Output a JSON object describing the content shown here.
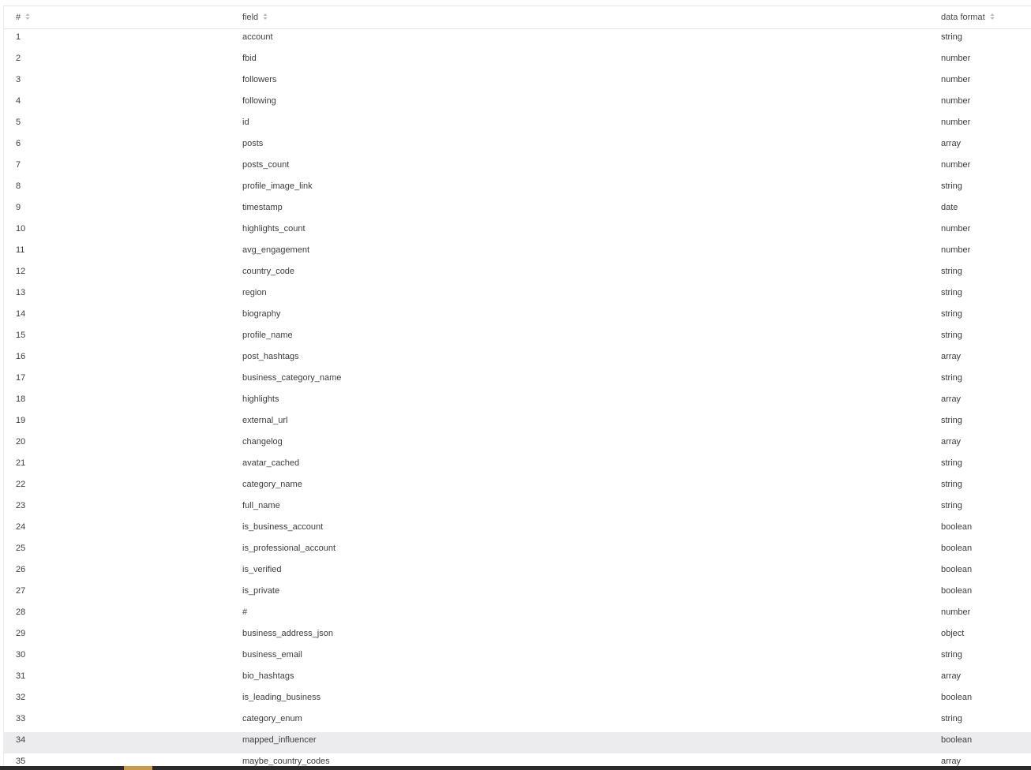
{
  "table": {
    "headers": {
      "index": "#",
      "field": "field",
      "format": "data format"
    },
    "rows": [
      {
        "n": "1",
        "field": "account",
        "format": "string"
      },
      {
        "n": "2",
        "field": "fbid",
        "format": "number"
      },
      {
        "n": "3",
        "field": "followers",
        "format": "number"
      },
      {
        "n": "4",
        "field": "following",
        "format": "number"
      },
      {
        "n": "5",
        "field": "id",
        "format": "number"
      },
      {
        "n": "6",
        "field": "posts",
        "format": "array"
      },
      {
        "n": "7",
        "field": "posts_count",
        "format": "number"
      },
      {
        "n": "8",
        "field": "profile_image_link",
        "format": "string"
      },
      {
        "n": "9",
        "field": "timestamp",
        "format": "date"
      },
      {
        "n": "10",
        "field": "highlights_count",
        "format": "number"
      },
      {
        "n": "11",
        "field": "avg_engagement",
        "format": "number"
      },
      {
        "n": "12",
        "field": "country_code",
        "format": "string"
      },
      {
        "n": "13",
        "field": "region",
        "format": "string"
      },
      {
        "n": "14",
        "field": "biography",
        "format": "string"
      },
      {
        "n": "15",
        "field": "profile_name",
        "format": "string"
      },
      {
        "n": "16",
        "field": "post_hashtags",
        "format": "array"
      },
      {
        "n": "17",
        "field": "business_category_name",
        "format": "string"
      },
      {
        "n": "18",
        "field": "highlights",
        "format": "array"
      },
      {
        "n": "19",
        "field": "external_url",
        "format": "string"
      },
      {
        "n": "20",
        "field": "changelog",
        "format": "array"
      },
      {
        "n": "21",
        "field": "avatar_cached",
        "format": "string"
      },
      {
        "n": "22",
        "field": "category_name",
        "format": "string"
      },
      {
        "n": "23",
        "field": "full_name",
        "format": "string"
      },
      {
        "n": "24",
        "field": "is_business_account",
        "format": "boolean"
      },
      {
        "n": "25",
        "field": "is_professional_account",
        "format": "boolean"
      },
      {
        "n": "26",
        "field": "is_verified",
        "format": "boolean"
      },
      {
        "n": "27",
        "field": "is_private",
        "format": "boolean"
      },
      {
        "n": "28",
        "field": "#",
        "format": "number"
      },
      {
        "n": "29",
        "field": "business_address_json",
        "format": "object"
      },
      {
        "n": "30",
        "field": "business_email",
        "format": "string"
      },
      {
        "n": "31",
        "field": "bio_hashtags",
        "format": "array"
      },
      {
        "n": "32",
        "field": "is_leading_business",
        "format": "boolean"
      },
      {
        "n": "33",
        "field": "category_enum",
        "format": "string"
      },
      {
        "n": "34",
        "field": "mapped_influencer",
        "format": "boolean",
        "highlighted": true
      },
      {
        "n": "35",
        "field": "maybe_country_codes",
        "format": "array"
      }
    ]
  },
  "icons": {
    "sort": "sort-icon"
  },
  "colors": {
    "highlight_row": "#ececee",
    "text": "#3d3d3d",
    "accent": "#c99a4a"
  }
}
